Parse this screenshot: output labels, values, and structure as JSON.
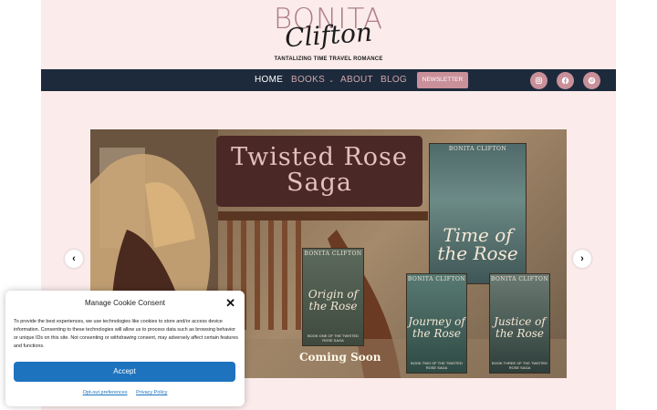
{
  "logo": {
    "top_text": "BONITA",
    "script_text": "Clifton",
    "tagline": "TANTALIZING TIME TRAVEL ROMANCE"
  },
  "nav": {
    "items": [
      {
        "label": "HOME",
        "active": true
      },
      {
        "label": "BOOKS",
        "active": false,
        "has_dropdown": true
      },
      {
        "label": "ABOUT",
        "active": false
      },
      {
        "label": "BLOG",
        "active": false
      }
    ],
    "newsletter_label": "NEWSLETTER",
    "social": [
      "instagram-icon",
      "facebook-icon",
      "pinterest-icon"
    ]
  },
  "hero": {
    "saga_title": "Twisted Rose Saga",
    "books": [
      {
        "author": "BONITA CLIFTON",
        "title": "Time of the Rose"
      },
      {
        "author": "BONITA CLIFTON",
        "title": "Origin of the Rose",
        "subtitle": "BOOK ONE OF THE TWISTED ROSE SAGA"
      },
      {
        "author": "BONITA CLIFTON",
        "title": "Journey of the Rose",
        "subtitle": "BOOK TWO OF THE TWISTED ROSE SAGA"
      },
      {
        "author": "BONITA CLIFTON",
        "title": "Justice of the Rose",
        "subtitle": "BOOK THREE OF THE TWISTED ROSE SAGA"
      }
    ],
    "coming_soon": "Coming Soon",
    "prev_icon": "chevron-left-icon",
    "next_icon": "chevron-right-icon"
  },
  "cookie": {
    "title": "Manage Cookie Consent",
    "body": "To provide the best experiences, we use technologies like cookies to store and/or access device information. Consenting to these technologies will allow us to process data such as browsing behavior or unique IDs on this site. Not consenting or withdrawing consent, may adversely affect certain features and functions.",
    "accept_label": "Accept",
    "opt_out_label": "Opt-out preferences",
    "privacy_label": "Privacy Policy"
  },
  "colors": {
    "page_bg": "#fbeceb",
    "nav_bg": "#1d2a3c",
    "accent_pink": "#c9909a",
    "button_blue": "#1e73be"
  }
}
